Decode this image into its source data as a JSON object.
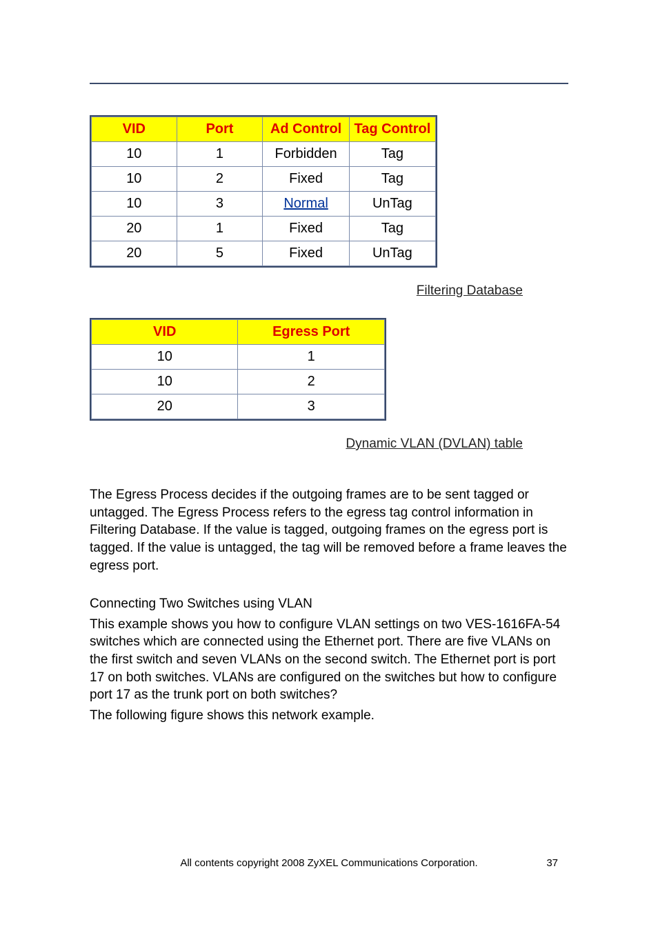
{
  "table1": {
    "headers": [
      "VID",
      "Port",
      "Ad Control",
      "Tag Control"
    ],
    "rows": [
      {
        "vid": "10",
        "port": "1",
        "ad": "Forbidden",
        "tag": "Tag",
        "ad_link": false
      },
      {
        "vid": "10",
        "port": "2",
        "ad": "Fixed",
        "tag": "Tag",
        "ad_link": false
      },
      {
        "vid": "10",
        "port": "3",
        "ad": "Normal",
        "tag": "UnTag",
        "ad_link": true
      },
      {
        "vid": "20",
        "port": "1",
        "ad": "Fixed",
        "tag": "Tag",
        "ad_link": false
      },
      {
        "vid": "20",
        "port": "5",
        "ad": "Fixed",
        "tag": "UnTag",
        "ad_link": false
      }
    ],
    "caption": " Filtering Database"
  },
  "table2": {
    "headers": [
      "VID",
      "Egress Port"
    ],
    "rows": [
      {
        "vid": "10",
        "egress": "1"
      },
      {
        "vid": "10",
        "egress": "2"
      },
      {
        "vid": "20",
        "egress": "3"
      }
    ],
    "caption": "Dynamic VLAN (DVLAN) table"
  },
  "para1": "The Egress Process decides if the outgoing frames are to be sent tagged or untagged. The Egress Process refers to the egress tag control information in Filtering Database. If the value is tagged, outgoing frames on the egress port is tagged. If the value is untagged, the tag will be removed before a frame leaves the egress port.",
  "para2_heading": "Connecting Two Switches using VLAN",
  "para2_body": "This example shows you how to configure VLAN settings on two VES-1616FA-54 switches which are connected using the Ethernet port. There are five VLANs on the first switch and seven VLANs on the second switch. The Ethernet port is port 17 on both switches. VLANs are configured on the switches but how to configure port 17 as the trunk port on both switches?",
  "para2_tail": "The following figure shows this network example.",
  "footer_copyright": "All contents copyright 2008 ZyXEL Communications Corporation.",
  "footer_page": "37"
}
